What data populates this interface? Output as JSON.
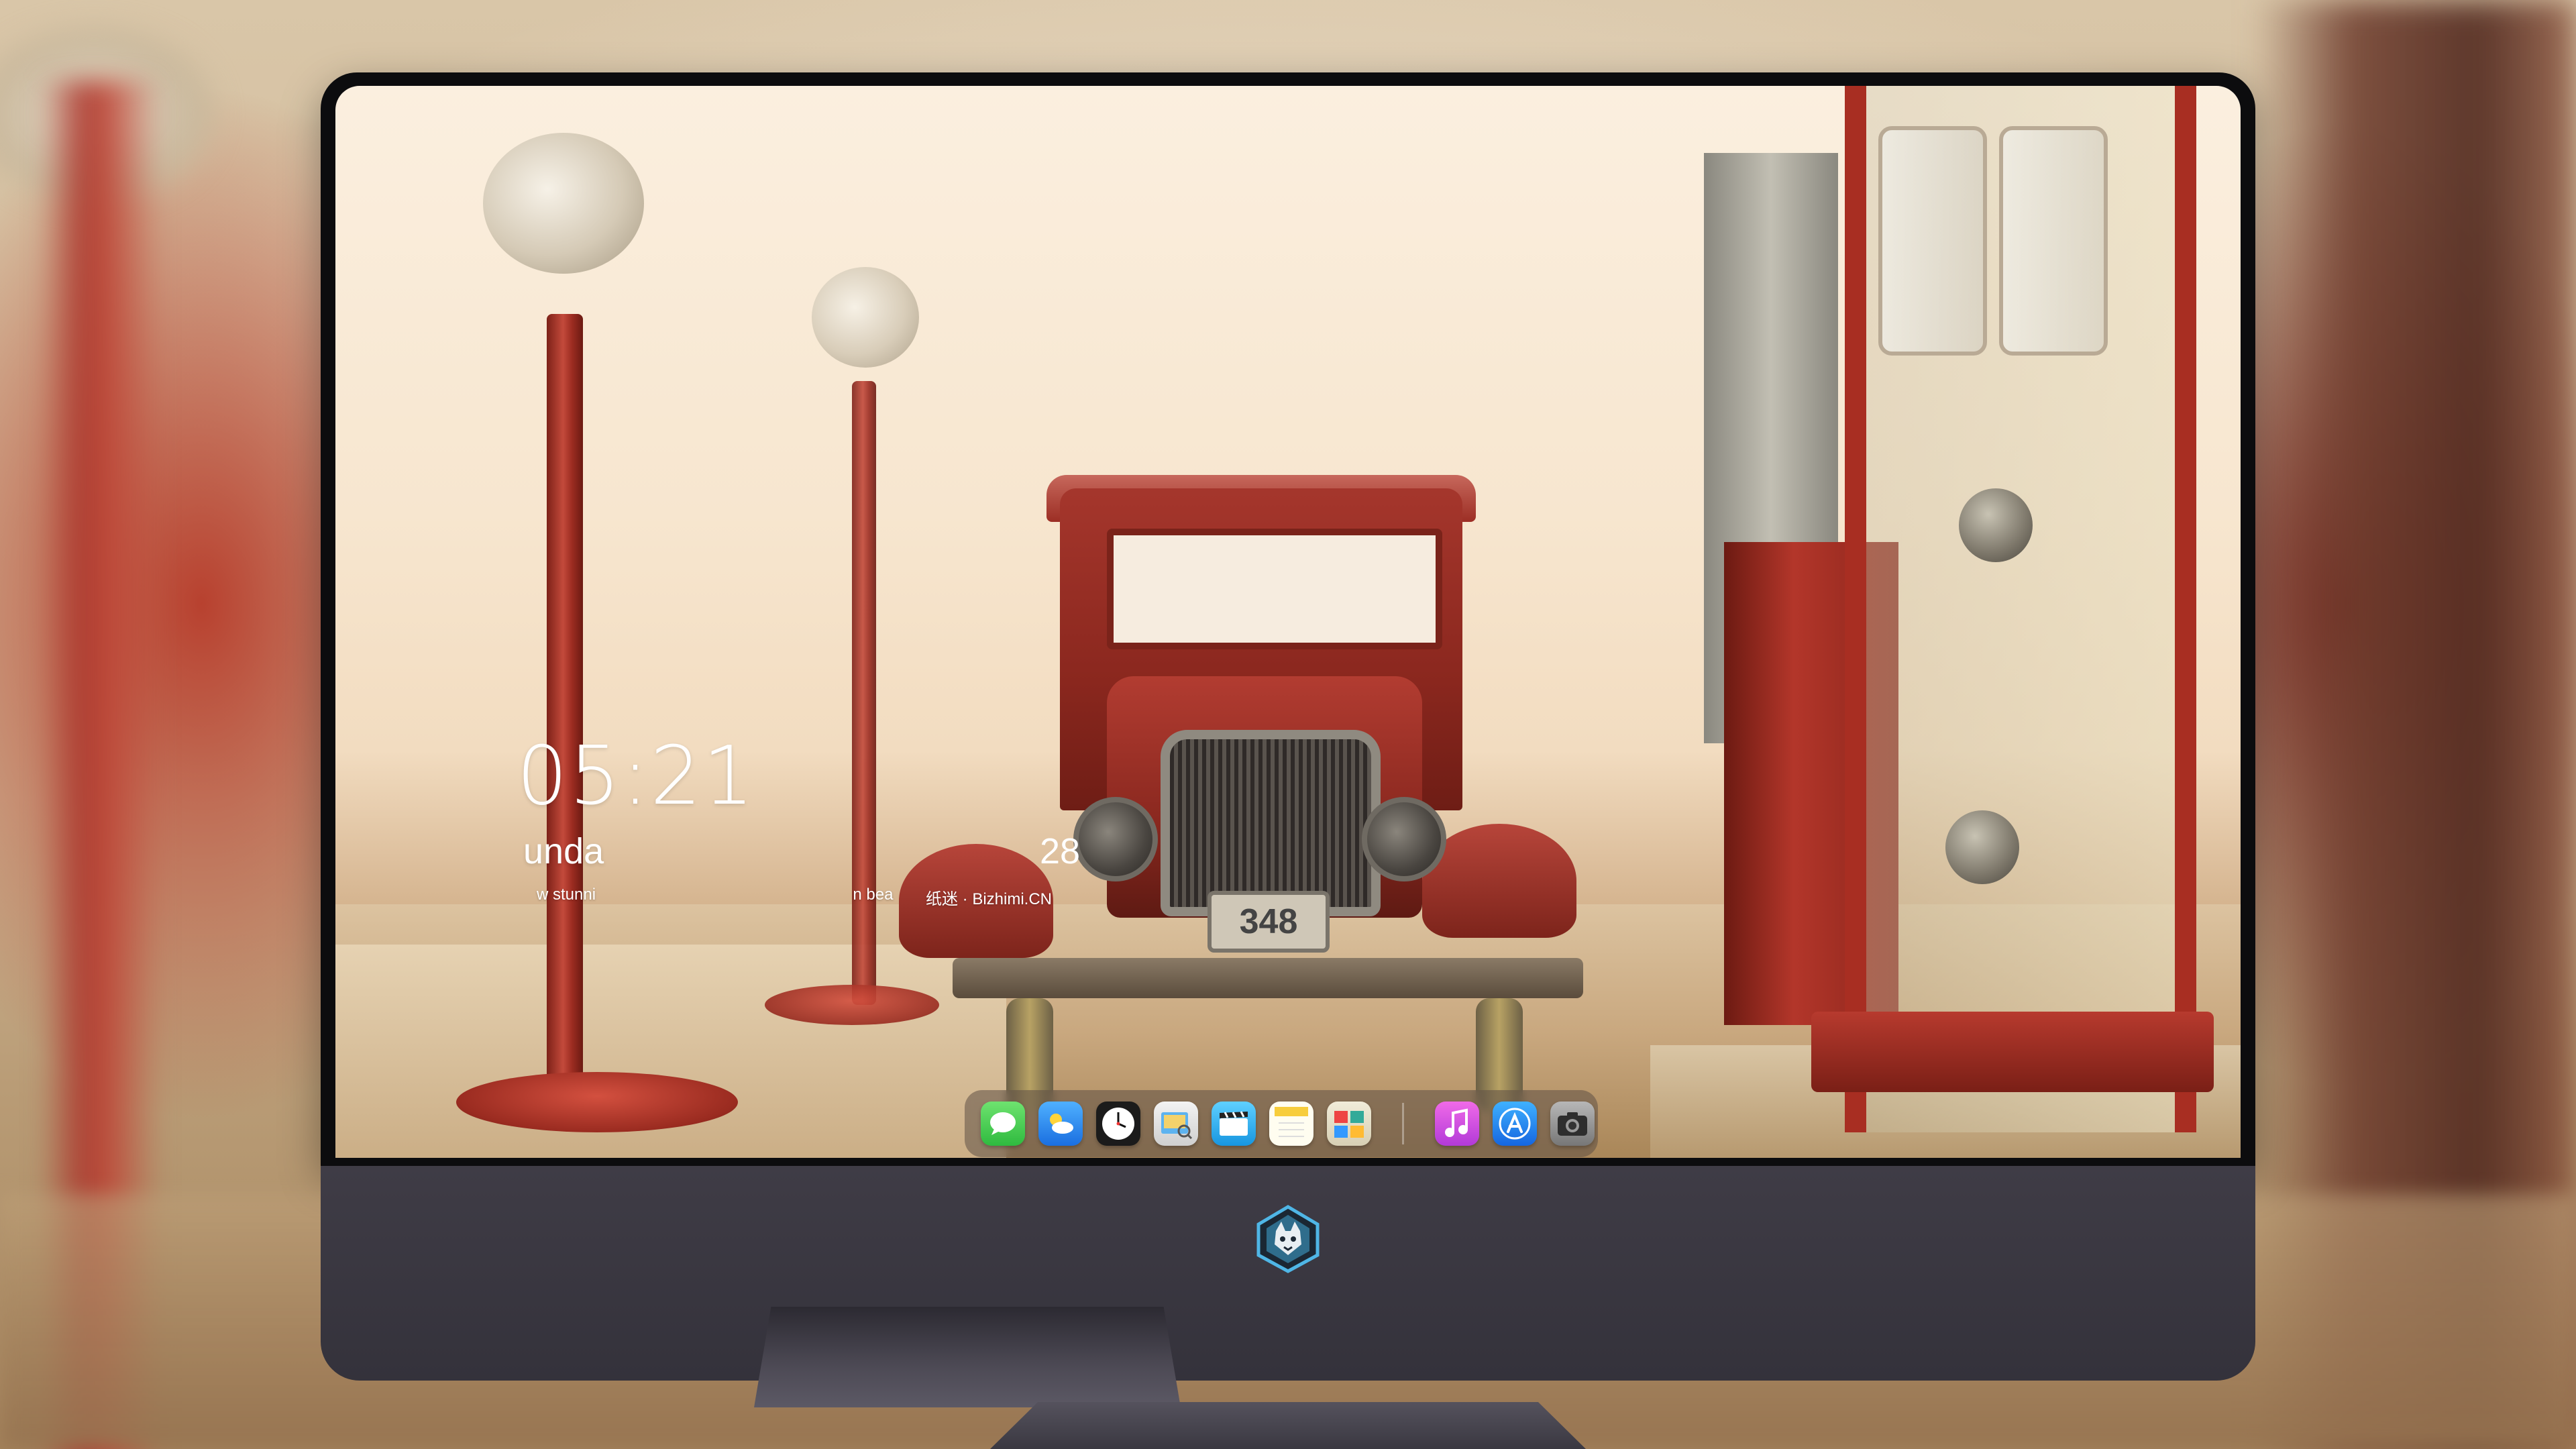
{
  "lockscreen": {
    "time": "05:21",
    "date_partial": "unda",
    "day_partial": "28",
    "caption_partial": "w stunni",
    "caption_partial_2": "n bea",
    "caption_credit": "纸迷 · Bizhimi.CN"
  },
  "wallpaper": {
    "truck_plate": "348"
  },
  "dock": {
    "background": "#5f5046",
    "items": [
      {
        "name": "messages-icon",
        "color": "#3ec64a"
      },
      {
        "name": "weather-icon",
        "color": "#2d8ff0"
      },
      {
        "name": "clock-icon",
        "color": "#1b1b1b"
      },
      {
        "name": "preview-icon",
        "color": "#e6e6e6"
      },
      {
        "name": "clips-icon",
        "color": "#3bb3f0"
      },
      {
        "name": "notes-icon",
        "color": "#f7d24a"
      },
      {
        "name": "photo-booth-icon",
        "color": "#e9e3cf"
      },
      {
        "name": "itunes-icon",
        "color": "#d03fd8"
      },
      {
        "name": "app-store-icon",
        "color": "#1e88f0"
      },
      {
        "name": "camera-icon",
        "color": "#8c8c8c"
      }
    ]
  },
  "monitor": {
    "logo": "wolf-mascot-logo",
    "chin_color": "#3a3841"
  }
}
